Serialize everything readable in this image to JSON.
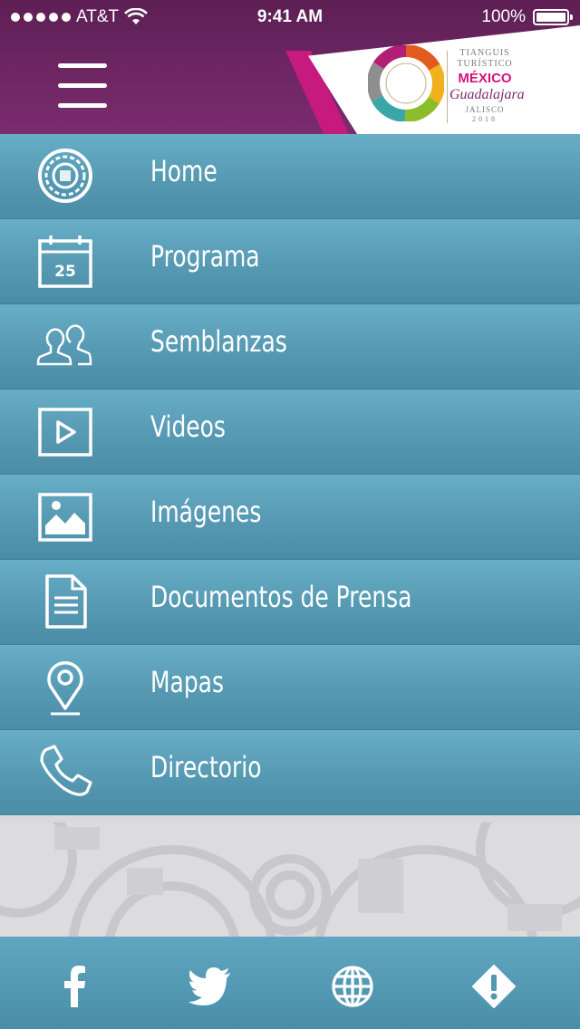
{
  "status_bar": {
    "carrier": "AT&T",
    "time": "9:41 AM",
    "battery": "100%",
    "signal_icon": "signal-dots-icon",
    "wifi_icon": "wifi-icon",
    "battery_icon": "battery-icon"
  },
  "header": {
    "menu_icon": "hamburger-menu-icon",
    "logo": {
      "line1": "TIANGUIS",
      "line2": "TURÍSTICO",
      "line3": "MÉXICO",
      "line4": "Guadalajara",
      "line5": "JALISCO",
      "line6": "2018"
    },
    "colors": {
      "purple": "#6b2461",
      "magenta": "#c61a7f"
    }
  },
  "menu": {
    "items": [
      {
        "label": "Home",
        "icon": "home-calendar-stone-icon"
      },
      {
        "label": "Programa",
        "icon": "calendar-icon",
        "icon_text": "25"
      },
      {
        "label": "Semblanzas",
        "icon": "people-icon"
      },
      {
        "label": "Videos",
        "icon": "video-play-icon"
      },
      {
        "label": "Imágenes",
        "icon": "image-icon"
      },
      {
        "label": "Documentos de Prensa",
        "icon": "document-icon"
      },
      {
        "label": "Mapas",
        "icon": "map-pin-icon"
      },
      {
        "label": "Directorio",
        "icon": "phone-icon"
      }
    ],
    "colors": {
      "row": "#5ba0b9"
    }
  },
  "footer": {
    "buttons": [
      {
        "icon": "facebook-icon"
      },
      {
        "icon": "twitter-icon"
      },
      {
        "icon": "globe-icon"
      },
      {
        "icon": "alert-icon"
      }
    ]
  }
}
